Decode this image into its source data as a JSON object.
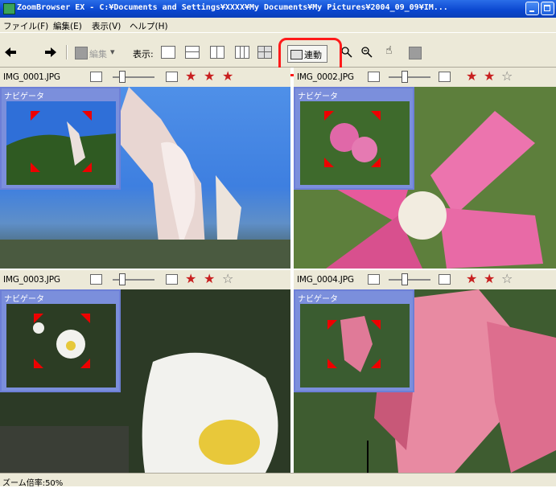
{
  "window": {
    "title": "ZoomBrowser EX - C:¥Documents and Settings¥XXXX¥My Documents¥My Pictures¥2004_09_09¥IM..."
  },
  "menu": [
    "ファイル(F)",
    "編集(E)",
    "表示(V)",
    "ヘルプ(H)"
  ],
  "toolbar": {
    "back_icon": "left-arrow",
    "forward_icon": "right-arrow",
    "edit_label": "編集",
    "display_label": "表示:",
    "link_label": "連動",
    "zoom_in_icon": "magnifier-plus",
    "zoom_out_icon": "magnifier-minus",
    "hand_icon": "hand-pan"
  },
  "panels": [
    {
      "filename": "IMG_0001.JPG",
      "navigator_label": "ナビゲータ",
      "rating_marked": 3,
      "rating_total": 3
    },
    {
      "filename": "IMG_0002.JPG",
      "navigator_label": "ナビゲータ",
      "rating_marked": 2,
      "rating_total": 3
    },
    {
      "filename": "IMG_0003.JPG",
      "navigator_label": "ナビゲータ",
      "rating_marked": 2,
      "rating_total": 3
    },
    {
      "filename": "IMG_0004.JPG",
      "navigator_label": "ナビゲータ",
      "rating_marked": 2,
      "rating_total": 3
    }
  ],
  "status": {
    "zoom_text": "ズーム倍率:50%"
  },
  "colors": {
    "highlight": "#ff1a1a",
    "titlebar": "#0a46cf",
    "navigator": "#7b8fdc"
  }
}
